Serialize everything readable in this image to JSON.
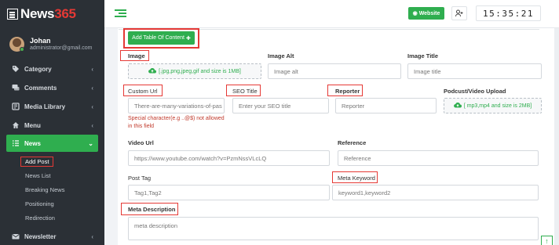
{
  "app": {
    "logo_text": "News",
    "logo_accent": "365"
  },
  "user": {
    "name": "Johan",
    "email": "administrator@gmail.com"
  },
  "sidebar": {
    "items": [
      {
        "label": "Category",
        "icon": "tag-icon"
      },
      {
        "label": "Comments",
        "icon": "comments-icon"
      },
      {
        "label": "Media Library",
        "icon": "media-icon"
      },
      {
        "label": "Menu",
        "icon": "home-icon"
      },
      {
        "label": "News",
        "icon": "list-icon"
      },
      {
        "label": "Newsletter",
        "icon": "envelope-icon"
      }
    ],
    "subitems": [
      "Add Post",
      "News List",
      "Breaking News",
      "Positioning",
      "Redirection"
    ]
  },
  "topbar": {
    "website_label": "Website",
    "clock": "15:35:21"
  },
  "form": {
    "toc_button": "Add Table Of Content",
    "image_label": "Image",
    "image_upload": "[.jpg,png,jpeg,gif and size is 1MB]",
    "image_alt_label": "Image Alt",
    "image_alt_placeholder": "Image alt",
    "image_title_label": "Image Title",
    "image_title_placeholder": "Image title",
    "custom_url_label": "Custom Url",
    "custom_url_value": "There-are-many-variations-of-pas",
    "custom_url_error": "Special character(e.g ..@$) not allowed in this field",
    "seo_title_label": "SEO Title",
    "seo_title_placeholder": "Enter your SEO title",
    "reporter_label": "Reporter",
    "reporter_placeholder": "Reporter",
    "podcast_label": "Podcust/Video Upload",
    "podcast_upload": "[ mp3,mp4 and size is 2MB]",
    "video_url_label": "Video Url",
    "video_url_value": "https://www.youtube.com/watch?v=PzmNssVLcLQ",
    "reference_label": "Reference",
    "reference_placeholder": "Reference",
    "post_tag_label": "Post Tag",
    "post_tag_placeholder": "Tag1,Tag2",
    "meta_keyword_label": "Meta Keyword",
    "meta_keyword_placeholder": "keyword1,keyword2",
    "meta_description_label": "Meta Description",
    "meta_description_placeholder": "meta description"
  },
  "colors": {
    "brand_green": "#2fae4f",
    "highlight_red": "#e53935",
    "sidebar_bg": "#2b3036"
  }
}
